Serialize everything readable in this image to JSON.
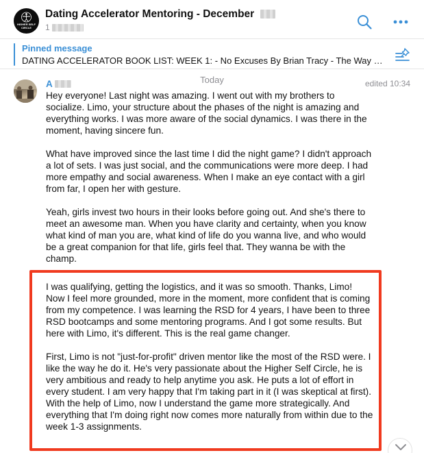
{
  "header": {
    "title": "Dating Accelerator Mentoring - December",
    "subtitle_prefix": "1",
    "logo_text": [
      "HIGHER SELF",
      "CIRCLE"
    ]
  },
  "pinned": {
    "label": "Pinned message",
    "text": "DATING ACCELERATOR BOOK LIST:   WEEK 1:  - No Excuses By Brian Tracy  - The Way of the Superior Man by David Deida"
  },
  "feed": {
    "date_separator": "Today",
    "message": {
      "sender_initial": "A",
      "edited_label": "edited 10:34",
      "paragraphs": [
        "Hey everyone! Last night was amazing. I went out with my brothers to socialize. Limo, your structure about the phases of the night is amazing and everything works. I was more aware of the social dynamics. I was there in the moment, having sincere fun.",
        "What have improved since the last time I did the night game? I didn't approach a lot of sets. I was just social, and the communications were more deep. I had more empathy and social awareness. When I make an eye contact with a girl from far, I open her with gesture.",
        "Yeah, girls invest two hours in their looks before going out. And she's there to meet an awesome man. When you have clarity and certainty, when you know what kind of man you are, what kind of life do you wanna live, and who would be a great companion for that life, girls feel that. They wanna be with the champ.",
        "I was qualifying, getting the logistics, and it was so smooth. Thanks, Limo! Now I feel more grounded, more in the moment, more confident that is coming from my competence. I was learning the RSD for 4 years, I have been to three RSD bootcamps and some mentoring programs. And I got some results. But here with Limo, it's different. This is the real game changer.",
        "First, Limo is not \"just-for-profit\" driven mentor like the most of the RSD were. I like the way he do it. He's very passionate about the Higher Self Circle, he is very ambitious and ready to help anytime you ask. He puts a lot of effort in every student. I am very happy that I'm taking part in it (I was skeptical at first). With the help of Limo, now I understand the game more strategically. And everything that I'm doing right now comes more naturally from within due to the week 1-3 assignments."
      ]
    }
  },
  "colors": {
    "accent": "#3a8fd6",
    "highlight": "#f03a1f",
    "muted": "#8e8e93"
  },
  "icons": {
    "search": "search-icon",
    "more": "more-options-icon",
    "pinned_list": "pinned-list-icon",
    "scroll_down": "chevron-down-icon"
  }
}
